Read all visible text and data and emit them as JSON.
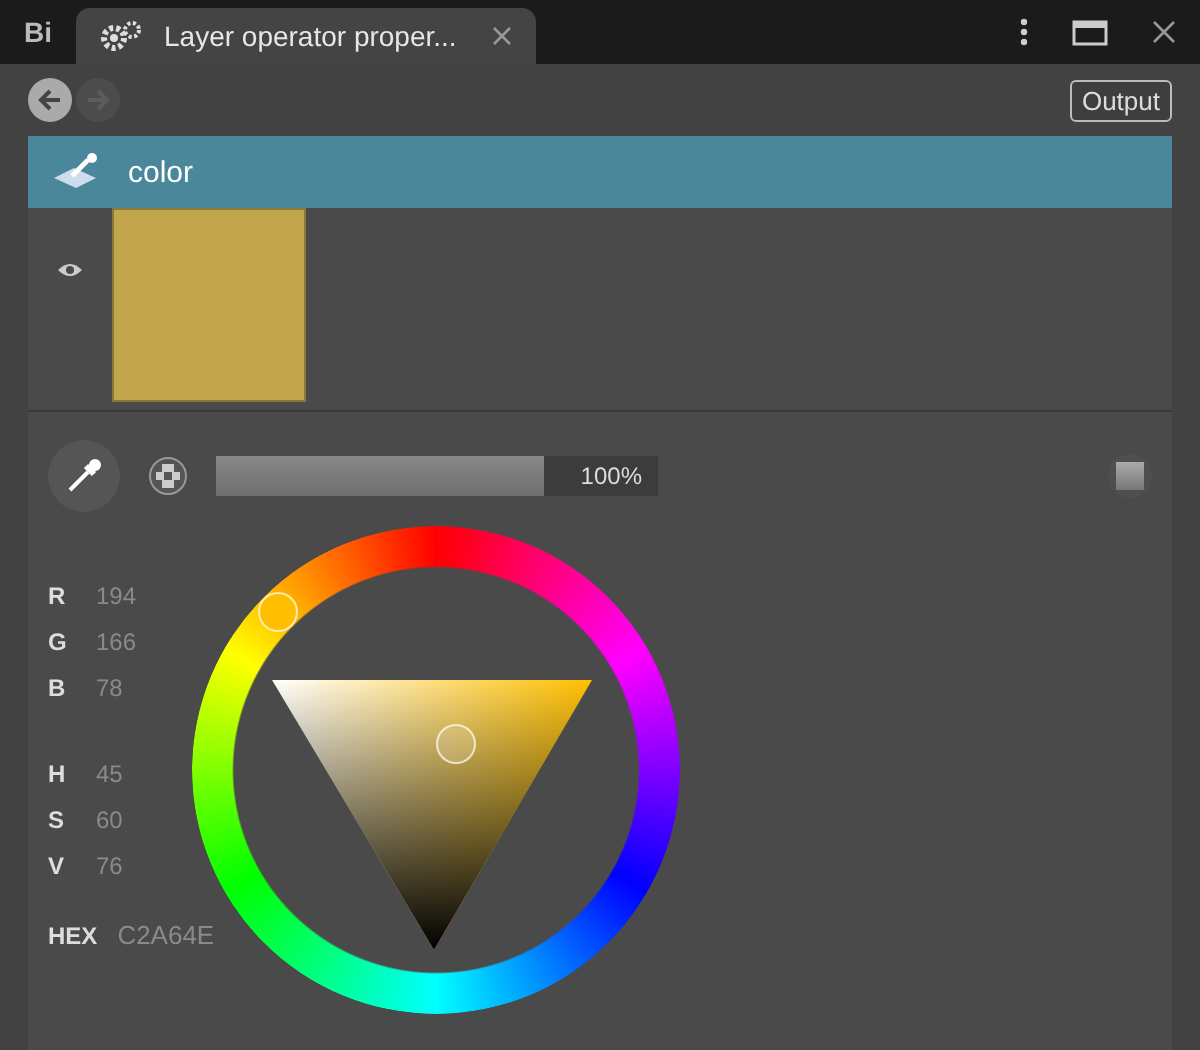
{
  "title_bar": {
    "app_badge": "Bi",
    "tab": {
      "title": "Layer operator proper...",
      "selected": true
    }
  },
  "toolbar": {
    "back": {
      "disabled": false
    },
    "forward": {
      "disabled": true
    },
    "output_button": "Output"
  },
  "layer": {
    "name": "color",
    "visible": true,
    "color": "#c2a64e"
  },
  "opacity": {
    "level": 0.74,
    "reading": "100%"
  },
  "rgb": [
    {
      "label": "R",
      "value": "194"
    },
    {
      "label": "G",
      "value": "166"
    },
    {
      "label": "B",
      "value": "78"
    }
  ],
  "hsv": [
    {
      "label": "H",
      "value": "45"
    },
    {
      "label": "S",
      "value": "60"
    },
    {
      "label": "V",
      "value": "76"
    }
  ],
  "hex": {
    "label": "HEX",
    "value": "C2A64E"
  }
}
